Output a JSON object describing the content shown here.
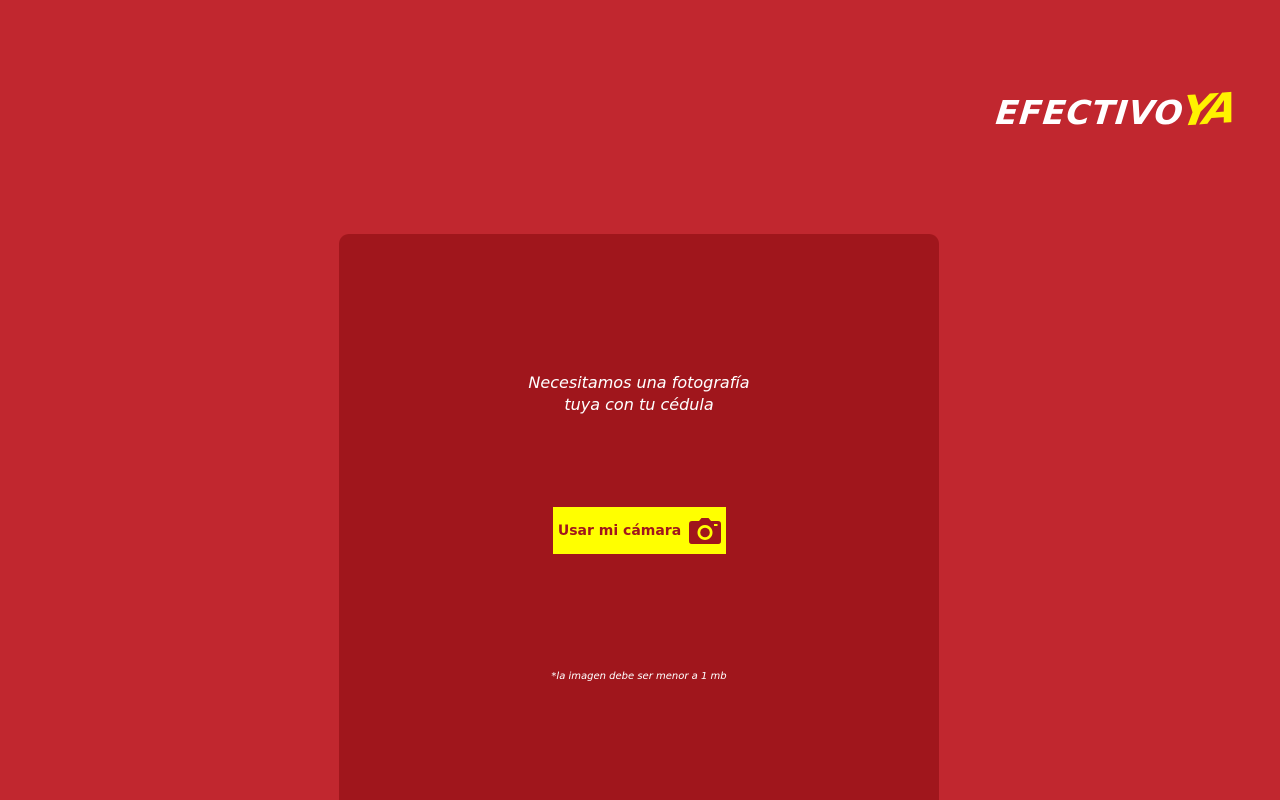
{
  "brand": {
    "logo_main": "EFECTIVO",
    "logo_accent": "YA",
    "accent_color": "#fff200",
    "background_color": "#c1272f",
    "card_color": "#a0161c"
  },
  "upload": {
    "headline_line1": "Necesitamos una fotografía",
    "headline_line2": "tuya con tu cédula",
    "camera_button_label": "Usar mi cámara",
    "camera_icon": "camera-icon",
    "size_note": "*la imagen debe ser menor a 1 mb"
  }
}
